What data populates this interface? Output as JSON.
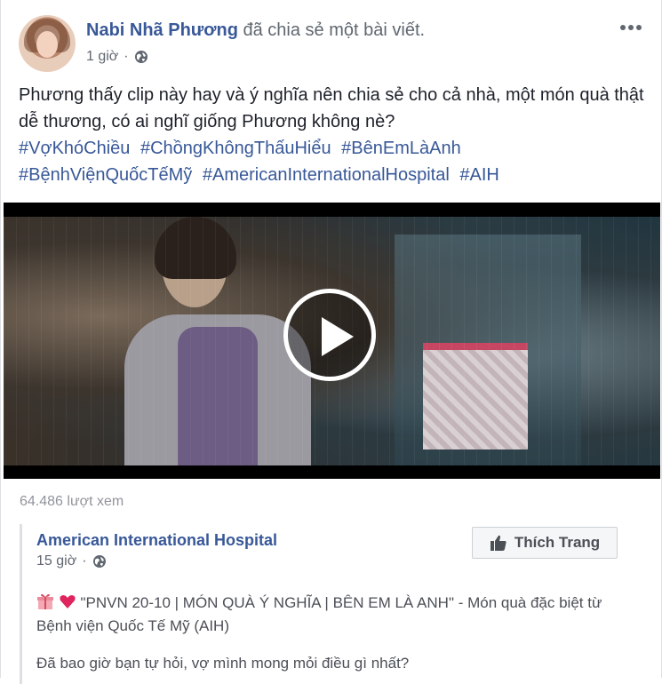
{
  "post": {
    "author": "Nabi Nhã Phương",
    "action": "đã chia sẻ một bài viết.",
    "time": "1 giờ",
    "separator": "·",
    "more_label": "More options",
    "text": "Phương thấy clip này hay và ý nghĩa nên chia sẻ cho cả nhà, một món quà thật dễ thương, có ai nghĩ giống Phương không nè?",
    "hashtags": [
      "#VợKhóChiều",
      "#ChồngKhôngThấuHiểu",
      "#BênEmLàAnh",
      "#BệnhViệnQuốcTếMỹ",
      "#AmericanInternationalHospital",
      "#AIH"
    ]
  },
  "video": {
    "views": "64.486 lượt xem"
  },
  "shared_post": {
    "page_name": "American International Hospital",
    "time": "15 giờ",
    "separator": "·",
    "like_button": "Thích Trang",
    "text": "\"PNVN 20-10 | MÓN QUÀ Ý NGHĨA | BÊN EM LÀ ANH\" - Món quà đặc biệt từ Bệnh viện Quốc Tế Mỹ (AIH)",
    "text2": "Đã bao giờ bạn tự hỏi, vợ mình mong mỏi điều gì nhất?"
  },
  "colors": {
    "link": "#385898",
    "muted": "#606770",
    "heart": "#e0245e",
    "gift": "#f3a8b4"
  },
  "icons": {
    "privacy": "globe-icon",
    "like": "thumbs-up-icon",
    "play": "play-icon",
    "gift": "gift-emoji",
    "heart": "heart-emoji"
  }
}
